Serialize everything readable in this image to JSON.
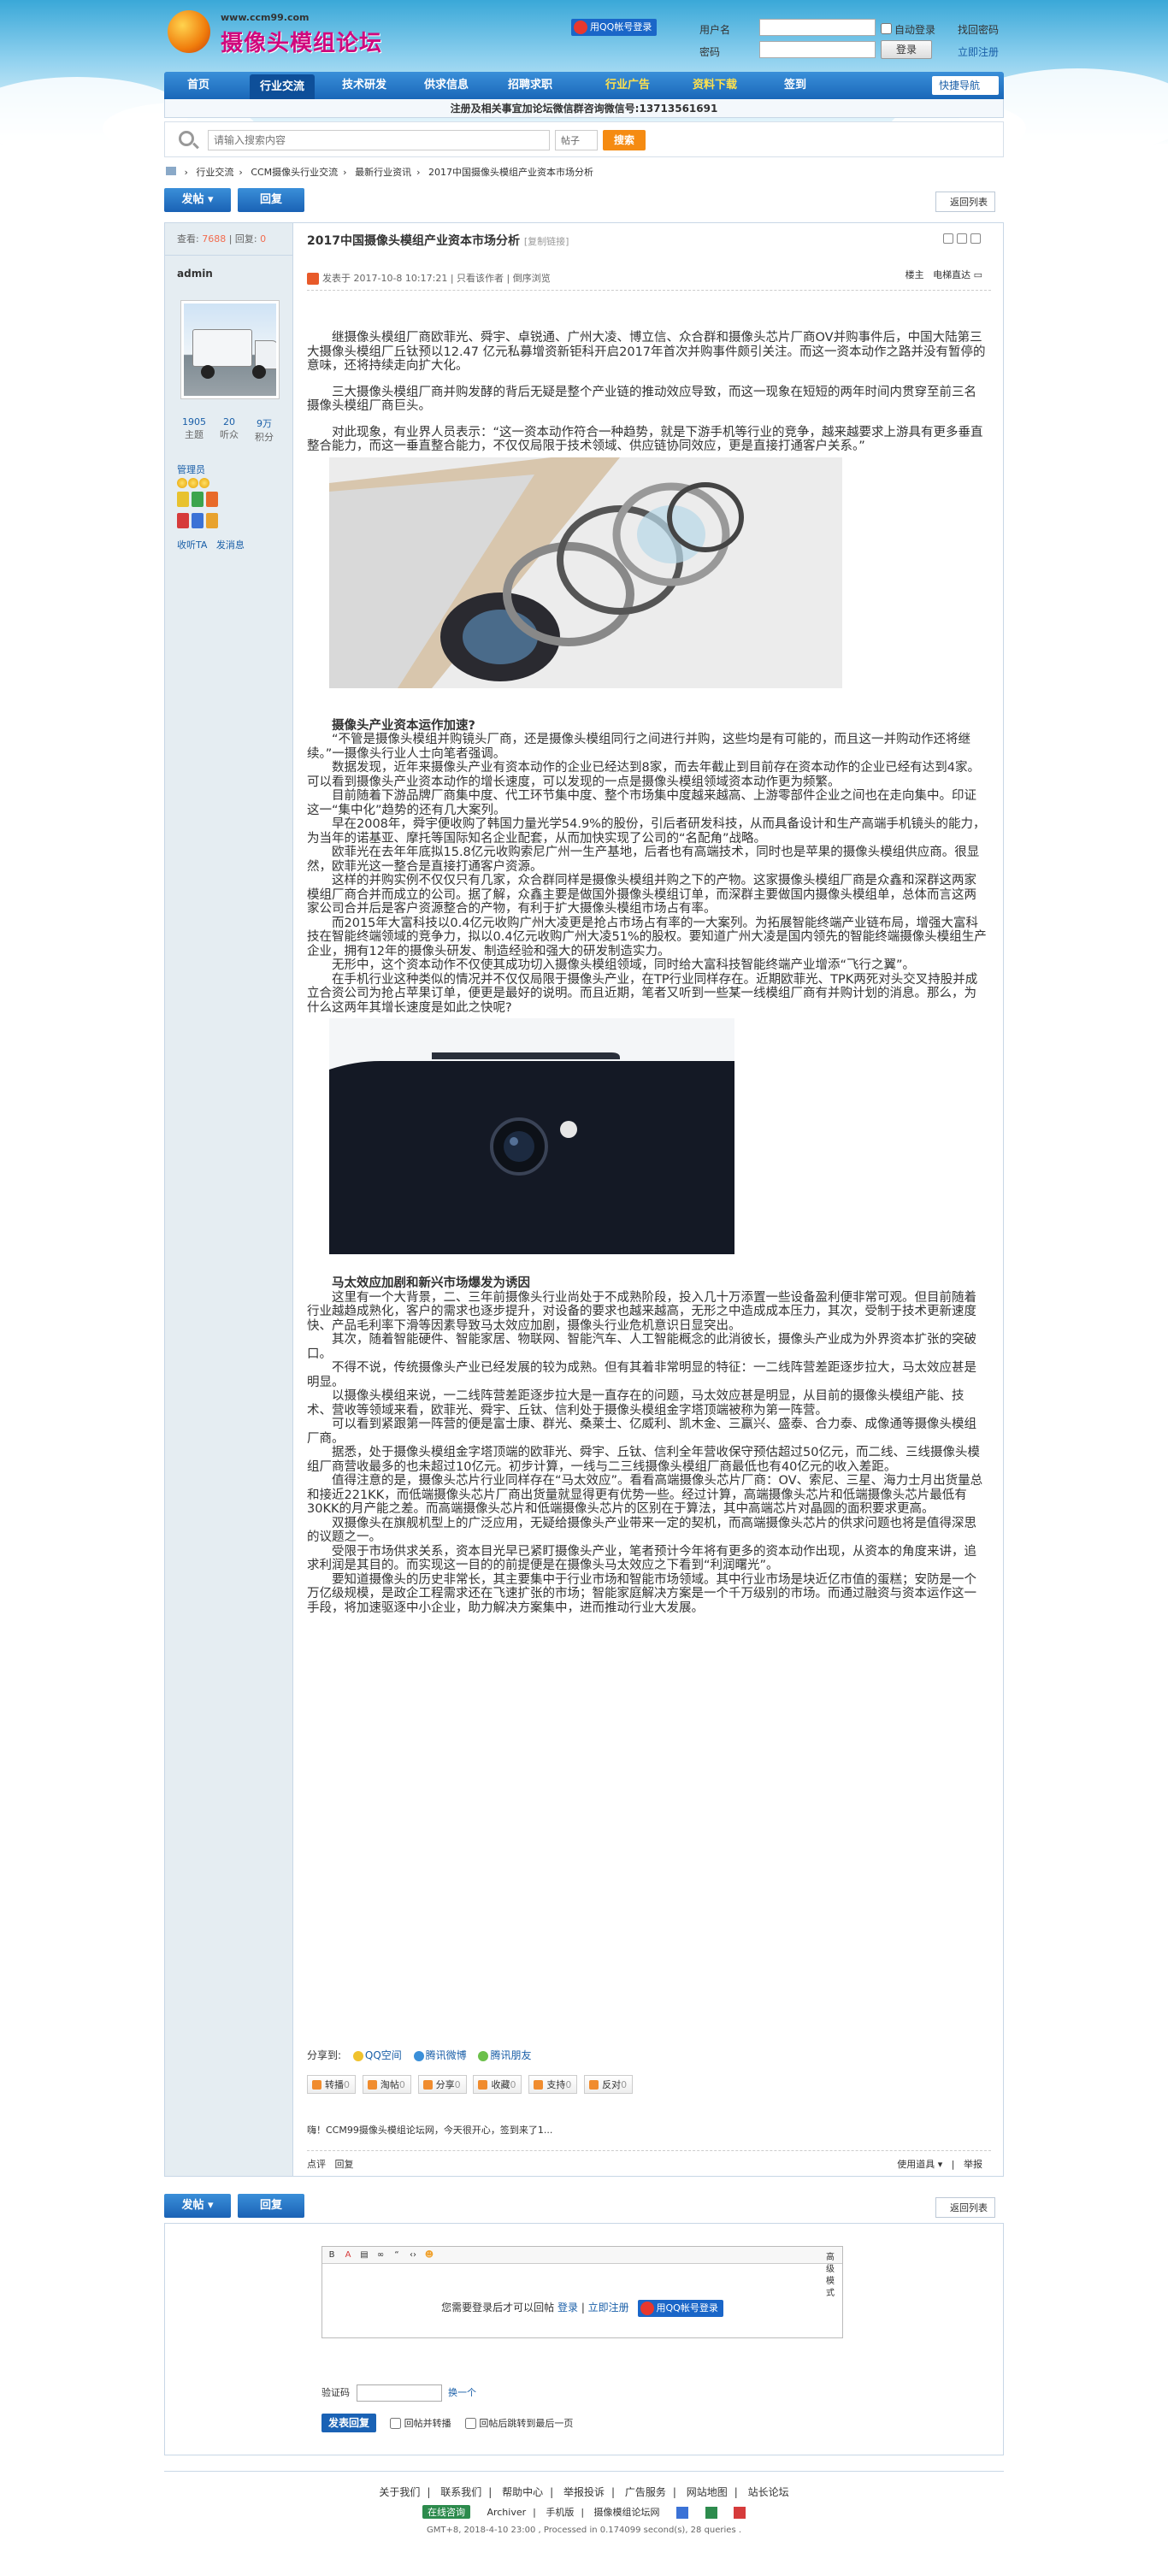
{
  "site": {
    "url": "www.ccm99.com",
    "title": "摄像头模组论坛"
  },
  "login": {
    "qq_button": "用QQ帐号登录",
    "username_label": "用户名",
    "password_label": "密码",
    "auto_login": "自动登录",
    "find_password": "找回密码",
    "login_button": "登录",
    "register": "立即注册"
  },
  "nav": {
    "items": [
      "首页",
      "行业交流",
      "技术研发",
      "供求信息",
      "招聘求职",
      "行业广告",
      "资料下载",
      "签到"
    ],
    "quick": "快捷导航"
  },
  "notice": "注册及相关事宜加论坛微信群咨询微信号:13713561691",
  "search": {
    "placeholder": "请输入搜索内容",
    "type": "帖子",
    "button": "搜索"
  },
  "breadcrumb": [
    "行业交流",
    "CCM摄像头行业交流",
    "最新行业资讯",
    "2017中国摄像头模组产业资本市场分析"
  ],
  "buttons": {
    "post": "发帖",
    "reply": "回复",
    "back": "返回列表"
  },
  "thread": {
    "views_label": "查看:",
    "views": "7688",
    "replies_label": "回复:",
    "replies": "0",
    "title": "2017中国摄像头模组产业资本市场分析",
    "copy_link": "[复制链接]",
    "posted": "发表于 2017-10-8 10:17:21",
    "only_author": "只看该作者",
    "reverse": "倒序浏览",
    "floor": "楼主",
    "jump": "电梯直达"
  },
  "author": {
    "name": "admin",
    "stats": [
      {
        "num": "1905",
        "label": "主题"
      },
      {
        "num": "20",
        "label": "听众"
      },
      {
        "num": "9万",
        "label": "积分"
      }
    ],
    "group": "管理员",
    "collect": "收听TA",
    "message": "发消息"
  },
  "article": {
    "p1": "继摄像头模组厂商欧菲光、舜宇、卓锐通、广州大凌、博立信、众合群和摄像头芯片厂商OV并购事件后，中国大陆第三大摄像头模组厂丘钛预以12.47 亿元私募增资新钜科开启2017年首次并购事件颇引关注。而这一资本动作之路并没有暂停的意味，还将持续走向扩大化。",
    "p2": "三大摄像头模组厂商并购发酵的背后无疑是整个产业链的推动效应导致，而这一现象在短短的两年时间内贯穿至前三名摄像头模组厂商巨头。",
    "p3": "对此现象，有业界人员表示：“这一资本动作符合一种趋势，就是下游手机等行业的竞争，越来越要求上游具有更多垂直整合能力，而这一垂直整合能力，不仅仅局限于技术领域、供应链协同效应，更是直接打通客户关系。”",
    "h1": "摄像头产业资本运作加速?",
    "s1": [
      "“不管是摄像头模组并购镜头厂商，还是摄像头模组同行之间进行并购，这些均是有可能的，而且这一并购动作还将继续。”一摄像头行业人士向笔者强调。",
      "数据发现，近年来摄像头产业有资本动作的企业已经达到8家，而去年截止到目前存在资本动作的企业已经有达到4家。可以看到摄像头产业资本动作的增长速度，可以发现的一点是摄像头模组领域资本动作更为频繁。",
      "目前随着下游品牌厂商集中度、代工环节集中度、整个市场集中度越来越高、上游零部件企业之间也在走向集中。印证这一“集中化”趋势的还有几大案列。",
      "早在2008年，舜宇便收购了韩国力量光学54.9%的股份，引后者研发科技，从而具备设计和生产高端手机镜头的能力，为当年的诺基亚、摩托等国际知名企业配套，从而加快实现了公司的“名配角”战略。",
      "欧菲光在去年年底拟15.8亿元收购索尼广州一生产基地，后者也有高端技术，同时也是苹果的摄像头模组供应商。很显然，欧菲光这一整合是直接打通客户资源。",
      "这样的并购实例不仅仅只有几家，众合群同样是摄像头模组并购之下的产物。这家摄像头模组厂商是众鑫和深群这两家模组厂商合并而成立的公司。据了解，众鑫主要是做国外摄像头模组订单，而深群主要做国内摄像头模组单，总体而言这两家公司合并后是客户资源整合的产物，有利于扩大摄像头模组市场占有率。",
      "而2015年大富科技以0.4亿元收购广州大凌更是抢占市场占有率的一大案列。为拓展智能终端产业链布局，增强大富科技在智能终端领域的竞争力，拟以0.4亿元收购广州大凌51%的股权。要知道广州大凌是国内领先的智能终端摄像头模组生产企业，拥有12年的摄像头研发、制造经验和强大的研发制造实力。",
      "无形中，这个资本动作不仅使其成功切入摄像头模组领域，同时给大富科技智能终端产业增添“飞行之翼”。",
      "在手机行业这种类似的情况并不仅仅局限于摄像头产业，在TP行业同样存在。近期欧菲光、TPK两死对头交叉持股并成立合资公司为抢占苹果订单，便更是最好的说明。而且近期，笔者又听到一些某一线模组厂商有并购计划的消息。那么，为什么这两年其增长速度是如此之快呢?"
    ],
    "h2": "马太效应加剧和新兴市场爆发为诱因",
    "s2": [
      "这里有一个大背景，二、三年前摄像头行业尚处于不成熟阶段，投入几十万添置一些设备盈利便非常可观。但目前随着行业越趋成熟化，客户的需求也逐步提升，对设备的要求也越来越高，无形之中造成成本压力，其次，受制于技术更新速度快、产品毛利率下滑等因素导致马太效应加剧，摄像头行业危机意识日显突出。",
      "其次，随着智能硬件、智能家居、物联网、智能汽车、人工智能概念的此消彼长，摄像头产业成为外界资本扩张的突破口。",
      "不得不说，传统摄像头产业已经发展的较为成熟。但有其着非常明显的特征：一二线阵营差距逐步拉大，马太效应甚是明显。",
      "以摄像头模组来说，一二线阵营差距逐步拉大是一直存在的问题，马太效应甚是明显，从目前的摄像头模组产能、技术、营收等领域来看，欧菲光、舜宇、丘钛、信利处于摄像头模组金字塔顶端被称为第一阵营。",
      "可以看到紧跟第一阵营的便是富士康、群光、桑莱士、亿威利、凯木金、三赢兴、盛泰、合力泰、成像通等摄像头模组厂商。",
      "据悉，处于摄像头模组金字塔顶端的欧菲光、舜宇、丘钛、信利全年营收保守预估超过50亿元，而二线、三线摄像头模组厂商营收最多的也未超过10亿元。初步计算，一线与二三线摄像头模组厂商最低也有40亿元的收入差距。",
      "值得注意的是，摄像头芯片行业同样存在“马太效应”。看看高端摄像头芯片厂商：OV、索尼、三星、海力士月出货量总和接近221KK，而低端摄像头芯片厂商出货量就显得更有优势一些。经过计算，高端摄像头芯片和低端摄像头芯片最低有30KK的月产能之差。而高端摄像头芯片和低端摄像头芯片的区别在于算法，其中高端芯片对晶圆的面积要求更高。",
      "双摄像头在旗舰机型上的广泛应用，无疑给摄像头产业带来一定的契机，而高端摄像头芯片的供求问题也将是值得深思的议题之一。",
      "受限于市场供求关系，资本目光早已紧盯摄像头产业，笔者预计今年将有更多的资本动作出现，从资本的角度来讲，追求利润是其目的。而实现这一目的的前提便是在摄像头马太效应之下看到“利润曙光”。",
      "要知道摄像头的历史非常长，其主要集中于行业市场和智能市场领域。其中行业市场是块近亿市值的蛋糕；安防是一个万亿级规模，是政企工程需求还在飞速扩张的市场；智能家庭解决方案是一个千万级别的市场。而通过融资与资本运作这一手段，将加速驱逐中小企业，助力解决方案集中，进而推动行业大发展。"
    ]
  },
  "share": {
    "label": "分享到:",
    "targets": [
      "QQ空间",
      "腾讯微博",
      "腾讯朋友"
    ]
  },
  "actions": [
    {
      "label": "转播",
      "count": "0"
    },
    {
      "label": "淘帖",
      "count": "0"
    },
    {
      "label": "分享",
      "count": "0"
    },
    {
      "label": "收藏",
      "count": "0"
    },
    {
      "label": "支持",
      "count": "0"
    },
    {
      "label": "反对",
      "count": "0"
    }
  ],
  "signature": "嗨！CCM99摄像头模组论坛网，今天很开心，签到来了1...",
  "post_foot": {
    "comment": "点评",
    "reply": "回复",
    "tools": "使用道具",
    "report": "举报"
  },
  "editor": {
    "advanced": "高级模式",
    "prompt": "您需要登录后才可以回帖",
    "login": "登录",
    "register": "立即注册",
    "qq": "用QQ帐号登录",
    "captcha_label": "验证码",
    "refresh": "换一个",
    "submit": "发表回复",
    "opt1": "回帖并转播",
    "opt2": "回帖后跳转到最后一页"
  },
  "footer": {
    "links": [
      "关于我们",
      "联系我们",
      "帮助中心",
      "举报投诉",
      "广告服务",
      "网站地图",
      "站长论坛"
    ],
    "badge": "在线咨询",
    "links2": [
      "Archiver",
      "手机版",
      "摄像模组论坛网"
    ],
    "processed": "GMT+8, 2018-4-10 23:00 , Processed in 0.174099 second(s), 28 queries ."
  }
}
